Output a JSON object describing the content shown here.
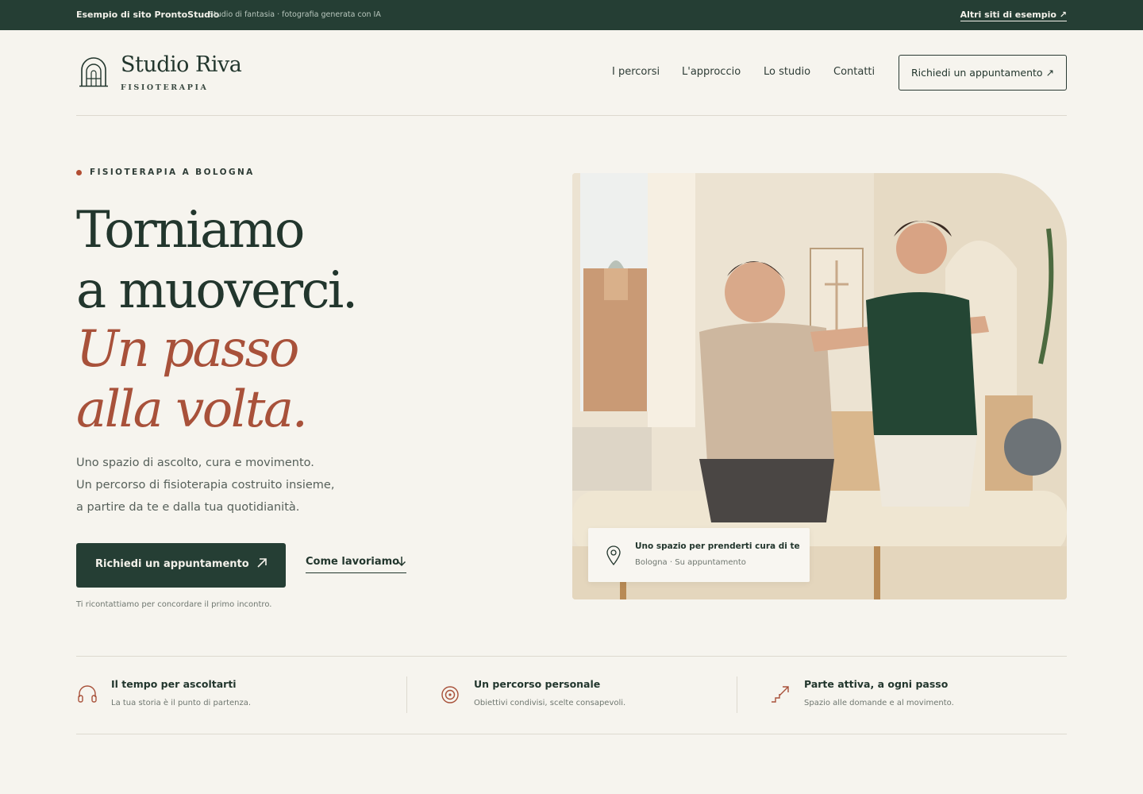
{
  "topbar": {
    "brand": "Esempio di sito ProntoStudio",
    "note": "Studio di fantasia · fotografia generata con IA",
    "other_sites": "Altri siti di esempio ↗"
  },
  "header": {
    "logo_name": "Studio Riva",
    "logo_sub": "FISIOTERAPIA",
    "nav": [
      "I percorsi",
      "L'approccio",
      "Lo studio",
      "Contatti"
    ],
    "cta": "Richiedi un appuntamento ↗"
  },
  "hero": {
    "eyebrow": "FISIOTERAPIA A BOLOGNA",
    "title_line1": "Torniamo",
    "title_line2": "a muoverci.",
    "title_line3": "Un passo",
    "title_line4": "alla volta.",
    "lead": [
      "Uno spazio di ascolto, cura e movimento.",
      "Un percorso di fisioterapia costruito insieme,",
      "a partire da te e dalla tua quotidianità."
    ],
    "primary_cta": "Richiedi un appuntamento",
    "primary_cta_icon": "arrow-up-right-icon",
    "secondary_cta": "Come lavoriamo",
    "secondary_cta_icon": "arrow-down-icon",
    "note": "Ti ricontattiamo per concordare il primo incontro."
  },
  "photo_card": {
    "title": "Uno spazio per prenderti cura di te",
    "subtitle": "Bologna · Su appuntamento",
    "icon": "location-pin-icon"
  },
  "features": [
    {
      "icon": "headphones-icon",
      "title": "Il tempo per ascoltarti",
      "desc": "La tua storia è il punto di partenza."
    },
    {
      "icon": "target-icon",
      "title": "Un percorso personale",
      "desc": "Obiettivi condivisi, scelte consapevoli."
    },
    {
      "icon": "stairs-arrow-icon",
      "title": "Parte attiva, a ogni passo",
      "desc": "Spazio alle domande e al movimento."
    }
  ],
  "colors": {
    "primary": "#253e34",
    "accent": "#a8513a",
    "background": "#f6f4ee"
  }
}
